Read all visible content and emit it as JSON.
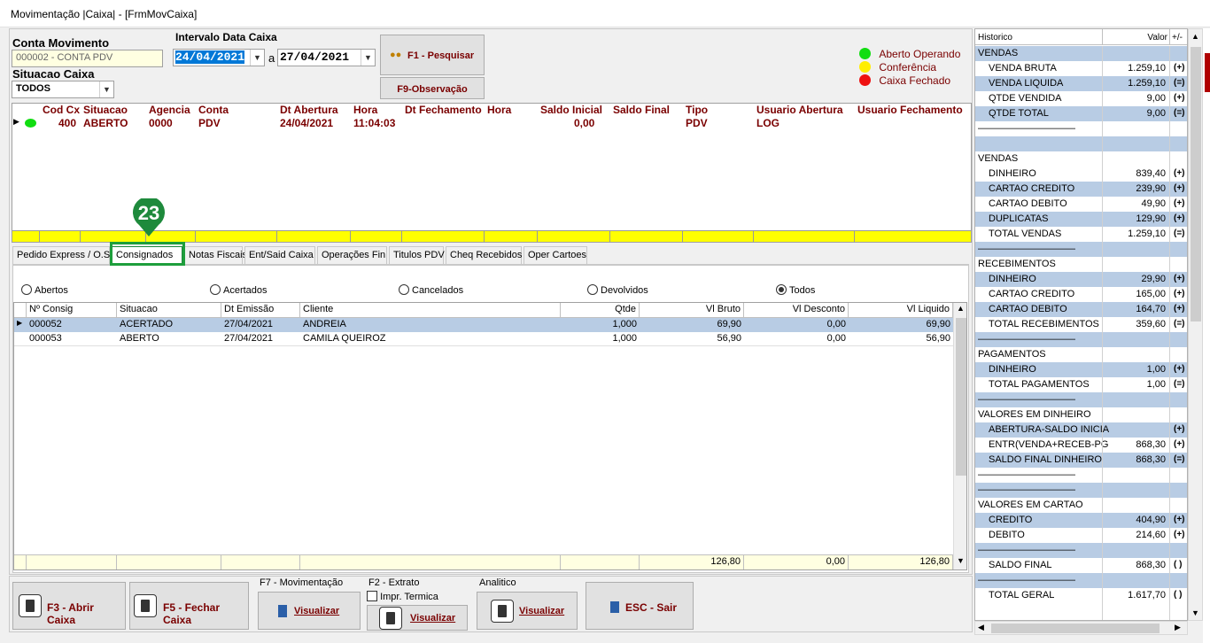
{
  "window": {
    "title": "Movimentação |Caixa| - [FrmMovCaixa]"
  },
  "filters": {
    "conta_label": "Conta Movimento",
    "conta_value": "000002 - CONTA PDV",
    "situacao_label": "Situacao Caixa",
    "situacao_value": "TODOS",
    "intervalo_label": "Intervalo Data Caixa",
    "date_from": "24/04/2021",
    "date_sep": "a",
    "date_to": "27/04/2021"
  },
  "buttons": {
    "pesquisar": "F1 - Pesquisar",
    "observacao": "F9-Observação",
    "abrir": "F3 - Abrir Caixa",
    "fechar": "F5 - Fechar Caixa",
    "mov_label": "F7 - Movimentação",
    "extrato_label": "F2 - Extrato",
    "impr_termica": "Impr. Termica",
    "analitico_label": "Analitico",
    "visualizar": "Visualizar",
    "sair": "ESC - Sair"
  },
  "legend": {
    "aberto": "Aberto Operando",
    "conferencia": "Conferência",
    "fechado": "Caixa Fechado"
  },
  "caixa_grid": {
    "headers": [
      "Cod Cx",
      "Situacao",
      "Agencia",
      "Conta",
      "Dt Abertura",
      "Hora",
      "Dt Fechamento",
      "Hora",
      "Saldo Inicial",
      "Saldo Final",
      "Tipo",
      "Usuario Abertura",
      "Usuario Fechamento"
    ],
    "row": [
      "400",
      "ABERTO",
      "0000",
      "PDV",
      "24/04/2021",
      "11:04:03",
      "",
      "",
      "0,00",
      "",
      "PDV",
      "LOG",
      ""
    ]
  },
  "badge": "23",
  "tabs": [
    "Pedido Express / O.S",
    "Consignados",
    "Notas Fiscais",
    "Ent/Said Caixa",
    "Operações Fin",
    "Titulos PDV",
    "Cheq Recebidos",
    "Oper Cartoes"
  ],
  "radios": [
    "Abertos",
    "Acertados",
    "Cancelados",
    "Devolvidos",
    "Todos"
  ],
  "consig_grid": {
    "headers": [
      "Nº Consig",
      "Situacao",
      "Dt Emissão",
      "Cliente",
      "Qtde",
      "Vl Bruto",
      "Vl Desconto",
      "Vl Liquido"
    ],
    "rows": [
      [
        "000052",
        "ACERTADO",
        "27/04/2021",
        "ANDREIA",
        "1,000",
        "69,90",
        "0,00",
        "69,90"
      ],
      [
        "000053",
        "ABERTO",
        "27/04/2021",
        "CAMILA QUEIROZ",
        "1,000",
        "56,90",
        "0,00",
        "56,90"
      ]
    ],
    "totals": [
      "126,80",
      "0,00",
      "126,80"
    ]
  },
  "side": {
    "hdr_historico": "Historico",
    "hdr_valor": "Valor",
    "hdr_pm": "+/-",
    "rows": [
      {
        "n": "VENDAS",
        "v": "",
        "s": "",
        "b": 1,
        "i": 0
      },
      {
        "n": "VENDA BRUTA",
        "v": "1.259,10",
        "s": "(+)",
        "b": 0,
        "i": 1
      },
      {
        "n": "VENDA LIQUIDA",
        "v": "1.259,10",
        "s": "(=)",
        "b": 1,
        "i": 1
      },
      {
        "n": "QTDE VENDIDA",
        "v": "9,00",
        "s": "(+)",
        "b": 0,
        "i": 1
      },
      {
        "n": "QTDE TOTAL",
        "v": "9,00",
        "s": "(=)",
        "b": 1,
        "i": 1
      },
      {
        "n": "——————————",
        "v": "",
        "s": "",
        "b": 0,
        "i": 0
      },
      {
        "n": "",
        "v": "",
        "s": "",
        "b": 1,
        "i": 0
      },
      {
        "n": "VENDAS",
        "v": "",
        "s": "",
        "b": 0,
        "i": 0
      },
      {
        "n": "DINHEIRO",
        "v": "839,40",
        "s": "(+)",
        "b": 0,
        "i": 1
      },
      {
        "n": "CARTAO CREDITO",
        "v": "239,90",
        "s": "(+)",
        "b": 1,
        "i": 1
      },
      {
        "n": "CARTAO DEBITO",
        "v": "49,90",
        "s": "(+)",
        "b": 0,
        "i": 1
      },
      {
        "n": "DUPLICATAS",
        "v": "129,90",
        "s": "(+)",
        "b": 1,
        "i": 1
      },
      {
        "n": "TOTAL VENDAS",
        "v": "1.259,10",
        "s": "(=)",
        "b": 0,
        "i": 1
      },
      {
        "n": "——————————",
        "v": "",
        "s": "",
        "b": 1,
        "i": 0
      },
      {
        "n": "RECEBIMENTOS",
        "v": "",
        "s": "",
        "b": 0,
        "i": 0
      },
      {
        "n": "DINHEIRO",
        "v": "29,90",
        "s": "(+)",
        "b": 1,
        "i": 1
      },
      {
        "n": "CARTAO CREDITO",
        "v": "165,00",
        "s": "(+)",
        "b": 0,
        "i": 1
      },
      {
        "n": "CARTAO DEBITO",
        "v": "164,70",
        "s": "(+)",
        "b": 1,
        "i": 1
      },
      {
        "n": "TOTAL RECEBIMENTOS",
        "v": "359,60",
        "s": "(=)",
        "b": 0,
        "i": 1
      },
      {
        "n": "——————————",
        "v": "",
        "s": "",
        "b": 1,
        "i": 0
      },
      {
        "n": "PAGAMENTOS",
        "v": "",
        "s": "",
        "b": 0,
        "i": 0
      },
      {
        "n": "DINHEIRO",
        "v": "1,00",
        "s": "(+)",
        "b": 1,
        "i": 1
      },
      {
        "n": "TOTAL PAGAMENTOS",
        "v": "1,00",
        "s": "(=)",
        "b": 0,
        "i": 1
      },
      {
        "n": "——————————",
        "v": "",
        "s": "",
        "b": 1,
        "i": 0
      },
      {
        "n": "VALORES EM DINHEIRO",
        "v": "",
        "s": "",
        "b": 0,
        "i": 0
      },
      {
        "n": "ABERTURA-SALDO INICIA",
        "v": "",
        "s": "(+)",
        "b": 1,
        "i": 1
      },
      {
        "n": "ENTR(VENDA+RECEB-PG",
        "v": "868,30",
        "s": "(+)",
        "b": 0,
        "i": 1
      },
      {
        "n": "SALDO FINAL DINHEIRO",
        "v": "868,30",
        "s": "(=)",
        "b": 1,
        "i": 1
      },
      {
        "n": "——————————",
        "v": "",
        "s": "",
        "b": 0,
        "i": 0
      },
      {
        "n": "——————————",
        "v": "",
        "s": "",
        "b": 1,
        "i": 0
      },
      {
        "n": "VALORES EM CARTAO",
        "v": "",
        "s": "",
        "b": 0,
        "i": 0
      },
      {
        "n": "CREDITO",
        "v": "404,90",
        "s": "(+)",
        "b": 1,
        "i": 1
      },
      {
        "n": "DEBITO",
        "v": "214,60",
        "s": "(+)",
        "b": 0,
        "i": 1
      },
      {
        "n": "——————————",
        "v": "",
        "s": "",
        "b": 1,
        "i": 0
      },
      {
        "n": "SALDO FINAL",
        "v": "868,30",
        "s": "( )",
        "b": 0,
        "i": 1
      },
      {
        "n": "——————————",
        "v": "",
        "s": "",
        "b": 1,
        "i": 0
      },
      {
        "n": "TOTAL GERAL",
        "v": "1.617,70",
        "s": "( )",
        "b": 0,
        "i": 1
      }
    ]
  },
  "colors": {
    "accent_red": "#7a0000",
    "highlight_blue": "#b8cce4",
    "badge_green": "#1e8a3c",
    "yellow_bar": "#ffff00"
  }
}
